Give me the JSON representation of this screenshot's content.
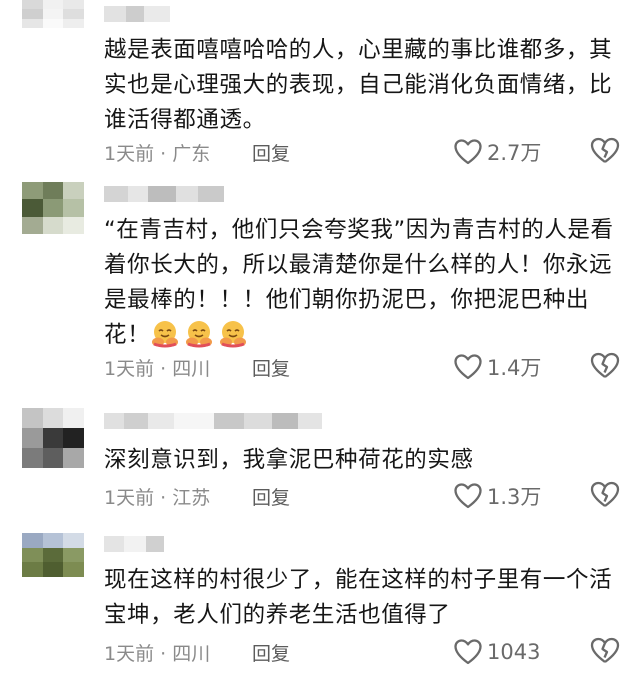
{
  "comments": [
    {
      "text": "越是表面嘻嘻哈哈的人，心里藏的事比谁都多，其实也是心理强大的表现，自己能消化负面情绪，比谁活得都通透。",
      "time_location": "1天前 · 广东",
      "reply_label": "回复",
      "likes": "2.7万"
    },
    {
      "text": "“在青吉村，他们只会夸奖我”因为青吉村的人是看着你长大的，所以最清楚你是什么样的人！你永远是最棒的！！！他们朝你扔泥巴，你把泥巴种出花！",
      "time_location": "1天前 · 四川",
      "reply_label": "回复",
      "likes": "1.4万"
    },
    {
      "text": "深刻意识到，我拿泥巴种荷花的实感",
      "time_location": "1天前 · 江苏",
      "reply_label": "回复",
      "likes": "1.3万"
    },
    {
      "text": "现在这样的村很少了，能在这样的村子里有一个活宝坤，老人们的养老生活也值得了",
      "time_location": "1天前 · 四川",
      "reply_label": "回复",
      "likes": "1043"
    }
  ],
  "icons": {
    "like": "heart-outline-icon",
    "dislike": "broken-heart-icon",
    "emoji": "hugging-face-emoji"
  },
  "colors": {
    "text": "#161616",
    "meta": "#8a8a8a",
    "icon": "#6a6a6a"
  }
}
